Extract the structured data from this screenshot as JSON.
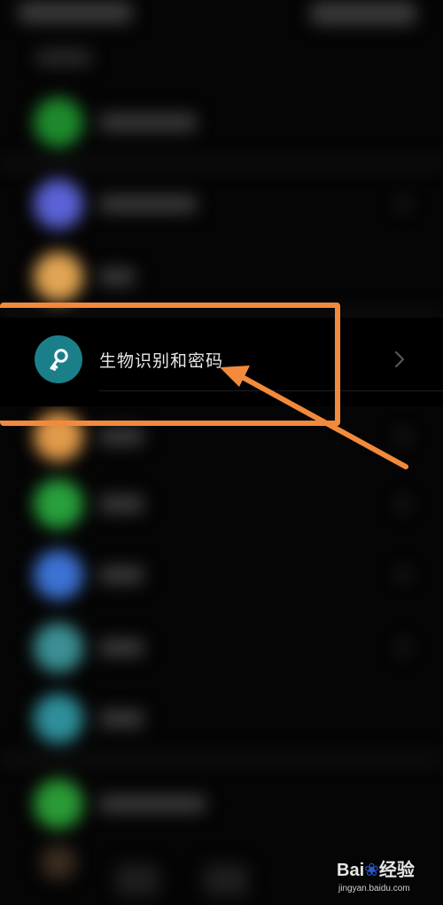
{
  "settings_item": {
    "label": "生物识别和密码",
    "icon": "key-icon",
    "icon_color": "#1b7f8a",
    "chevron": "chevron-right-icon"
  },
  "annotation": {
    "color": "#f28a3c"
  },
  "watermark": {
    "brand_prefix": "Bai",
    "brand_suffix": "经验",
    "url": "jingyan.baidu.com"
  }
}
